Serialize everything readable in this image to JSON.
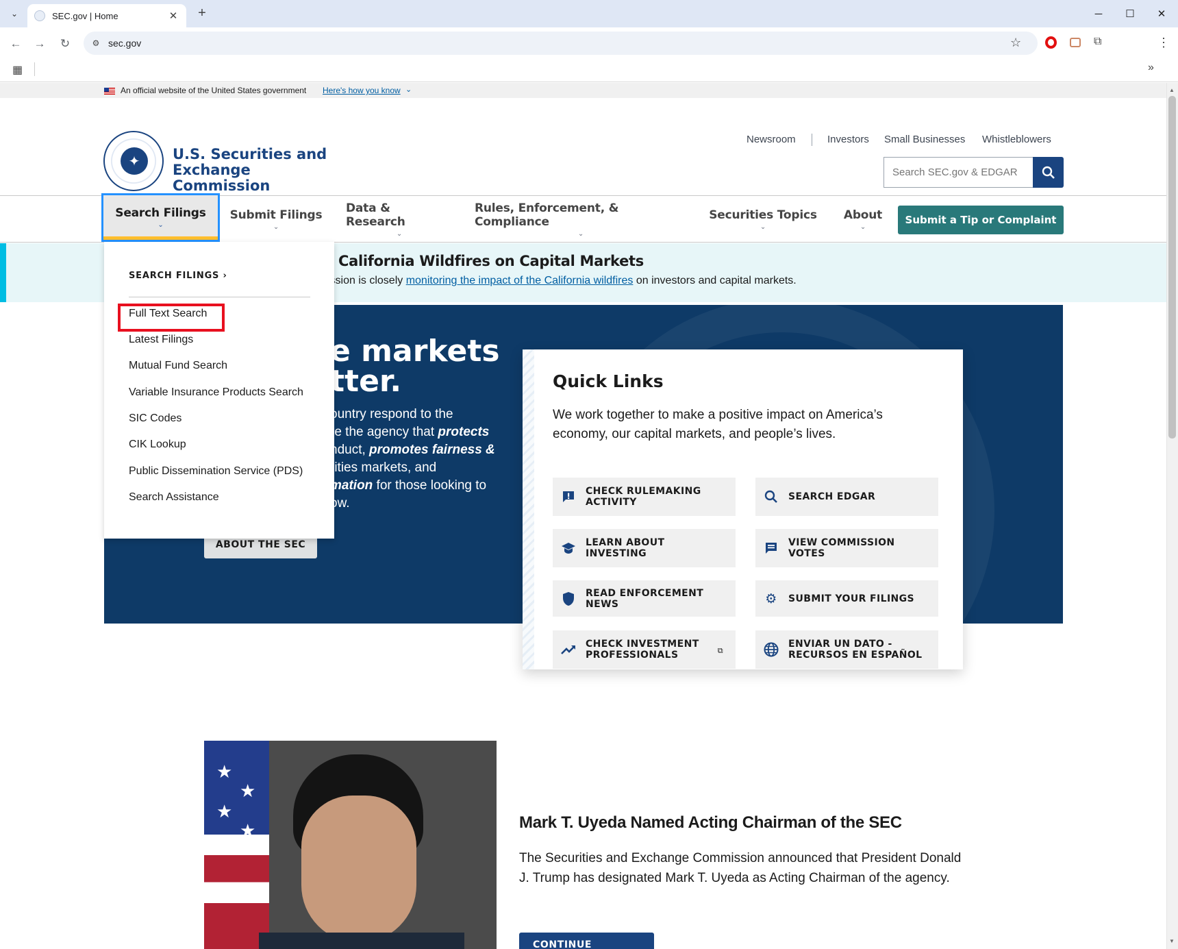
{
  "browser": {
    "tab_title": "SEC.gov | Home",
    "url": "sec.gov"
  },
  "gov_banner": {
    "text": "An official website of the United States government",
    "link": "Here's how you know"
  },
  "header": {
    "org_name": "U.S. Securities and Exchange Commission",
    "utility_links": [
      "Newsroom",
      "Investors",
      "Small Businesses",
      "Whistleblowers"
    ],
    "search_placeholder": "Search SEC.gov & EDGAR"
  },
  "nav": {
    "items": [
      "Search Filings",
      "Submit Filings",
      "Data & Research",
      "Rules, Enforcement, & Compliance",
      "Securities Topics",
      "About"
    ],
    "active": "Search Filings",
    "cta": "Submit a Tip or Complaint"
  },
  "dropdown": {
    "heading": "SEARCH FILINGS ›",
    "items": [
      "Full Text Search",
      "Latest Filings",
      "Mutual Fund Search",
      "Variable Insurance Products Search",
      "SIC Codes",
      "CIK Lookup",
      "Public Dissemination Service (PDS)",
      "Search Assistance"
    ],
    "highlighted": "Full Text Search"
  },
  "alert": {
    "title": "California Wildfires on Capital Markets",
    "text_before": "ission is closely ",
    "link": "monitoring the impact of the California wildfires",
    "text_after": " on investors and capital markets."
  },
  "hero": {
    "title": "e markets\ntter.",
    "body_lines": [
      "ountry respond to the",
      "re the agency that protects",
      "nduct, promotes fairness &",
      "rities markets, and",
      "mation for those looking to",
      "ow."
    ],
    "button": "ABOUT THE SEC"
  },
  "quick_links": {
    "title": "Quick Links",
    "description": "We work together to make a positive impact on America’s economy, our capital markets, and people’s lives.",
    "links": [
      {
        "label": "CHECK RULEMAKING ACTIVITY",
        "icon": "announcement-icon"
      },
      {
        "label": "SEARCH EDGAR",
        "icon": "search-icon"
      },
      {
        "label": "LEARN ABOUT INVESTING",
        "icon": "graduation-cap-icon"
      },
      {
        "label": "VIEW COMMISSION VOTES",
        "icon": "comment-icon"
      },
      {
        "label": "READ ENFORCEMENT NEWS",
        "icon": "shield-icon"
      },
      {
        "label": "SUBMIT YOUR FILINGS",
        "icon": "gear-icon"
      },
      {
        "label": "CHECK INVESTMENT PROFESSIONALS",
        "icon": "trending-up-icon"
      },
      {
        "label": "ENVIAR UN DATO - RECURSOS EN ESPAÑOL",
        "icon": "globe-icon"
      }
    ]
  },
  "news": {
    "title": "Mark T. Uyeda Named Acting Chairman of the SEC",
    "body": "The Securities and Exchange Commission announced that President Donald J. Trump has designated Mark T. Uyeda as Acting Chairman of the agency.",
    "button": "CONTINUE READING"
  },
  "colors": {
    "primary": "#1a4480",
    "hero_bg": "#0e3a67",
    "cta": "#29797a",
    "alert_bg": "#e7f6f8",
    "highlight": "#e8101f"
  }
}
